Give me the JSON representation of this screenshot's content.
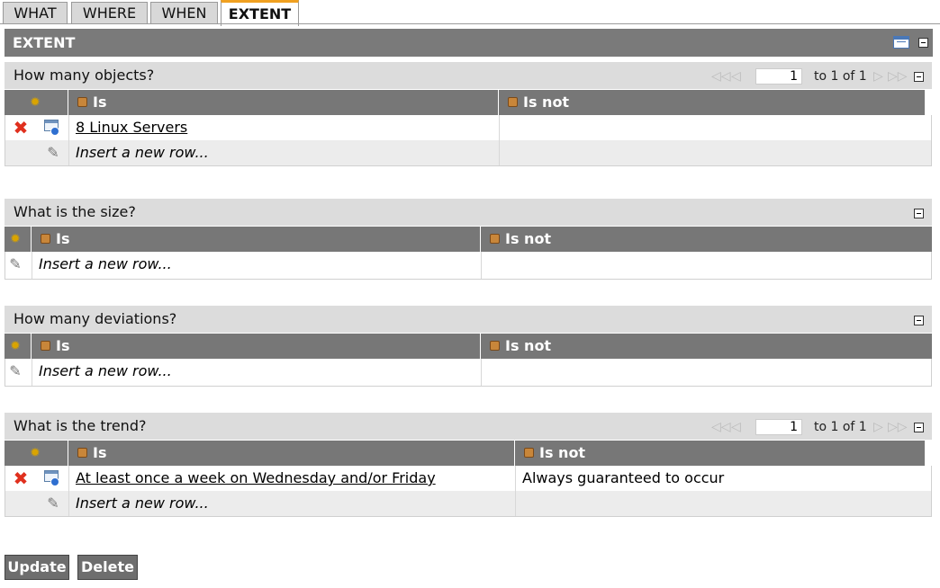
{
  "tabs": [
    {
      "label": "WHAT"
    },
    {
      "label": "WHERE"
    },
    {
      "label": "WHEN"
    },
    {
      "label": "EXTENT"
    }
  ],
  "active_tab": "EXTENT",
  "main_header": "EXTENT",
  "sections": {
    "objects": {
      "title": "How many objects?",
      "col_is": "Is",
      "col_isnot": "Is not",
      "rows": [
        {
          "is": "8 Linux Servers",
          "isnot": ""
        }
      ],
      "insert_text": "Insert a new row...",
      "pager": {
        "page": "1",
        "to_text": "to 1 of 1"
      }
    },
    "size": {
      "title": "What is the size?",
      "col_is": "Is",
      "col_isnot": "Is not",
      "insert_text": "Insert a new row..."
    },
    "deviations": {
      "title": "How many deviations?",
      "col_is": "Is",
      "col_isnot": "Is not",
      "insert_text": "Insert a new row..."
    },
    "trend": {
      "title": "What is the trend?",
      "col_is": "Is",
      "col_isnot": "Is not",
      "rows": [
        {
          "is": "At least once a week on Wednesday and/or Friday",
          "isnot": "Always guaranteed to occur"
        }
      ],
      "insert_text": "Insert a new row...",
      "pager": {
        "page": "1",
        "to_text": "to 1 of 1"
      }
    }
  },
  "buttons": {
    "update": "Update",
    "delete": "Delete"
  },
  "colors": {
    "header_dark": "#7a7a7a",
    "section_light": "#dcdcdc",
    "active_tab_accent": "#f0a020",
    "delete_red": "#e0301e"
  }
}
